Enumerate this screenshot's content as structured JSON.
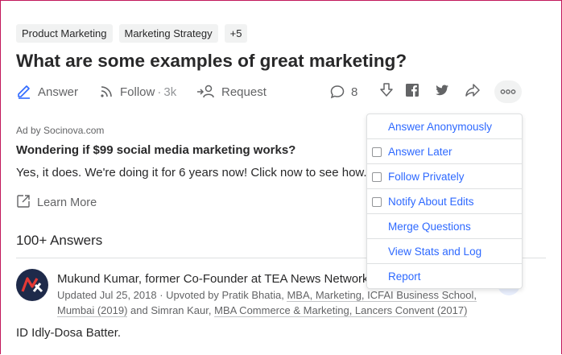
{
  "topics": [
    "Product Marketing",
    "Marketing Strategy",
    "+5"
  ],
  "question": {
    "title": "What are some examples of great marketing?"
  },
  "actions": {
    "answer_label": "Answer",
    "follow_label": "Follow",
    "follow_sep": "·",
    "follow_count": "3k",
    "request_label": "Request",
    "comment_count": "8"
  },
  "menu": {
    "items": [
      {
        "label": "Answer Anonymously",
        "checkbox": false
      },
      {
        "label": "Answer Later",
        "checkbox": true
      },
      {
        "label": "Follow Privately",
        "checkbox": true
      },
      {
        "label": "Notify About Edits",
        "checkbox": true
      },
      {
        "label": "Merge Questions",
        "checkbox": false
      },
      {
        "label": "View Stats and Log",
        "checkbox": false
      },
      {
        "label": "Report",
        "checkbox": false
      }
    ]
  },
  "ad": {
    "by": "Ad by Socinova.com",
    "title": "Wondering if $99 social media marketing works?",
    "body": "Yes, it does. We're doing it for 6 years now! Click now to see how.",
    "learn_more": "Learn More"
  },
  "answers": {
    "header": "100+ Answers",
    "first": {
      "author": "Mukund Kumar, former Co-Founder at TEA News Network",
      "meta_prefix": "Updated Jul 25, 2018 · Upvoted by Pratik Bhatia, ",
      "meta_link1": "MBA, Marketing, ICFAI Business School, Mumbai (2019)",
      "meta_mid": " and Simran Kaur, ",
      "meta_link2": "MBA Commerce & Marketing, Lancers Convent (2017)",
      "text": "ID Idly-Dosa Batter."
    }
  },
  "colors": {
    "accent": "#2e69ff",
    "text": "#282829",
    "muted": "#636466",
    "frame": "#c2185b"
  }
}
